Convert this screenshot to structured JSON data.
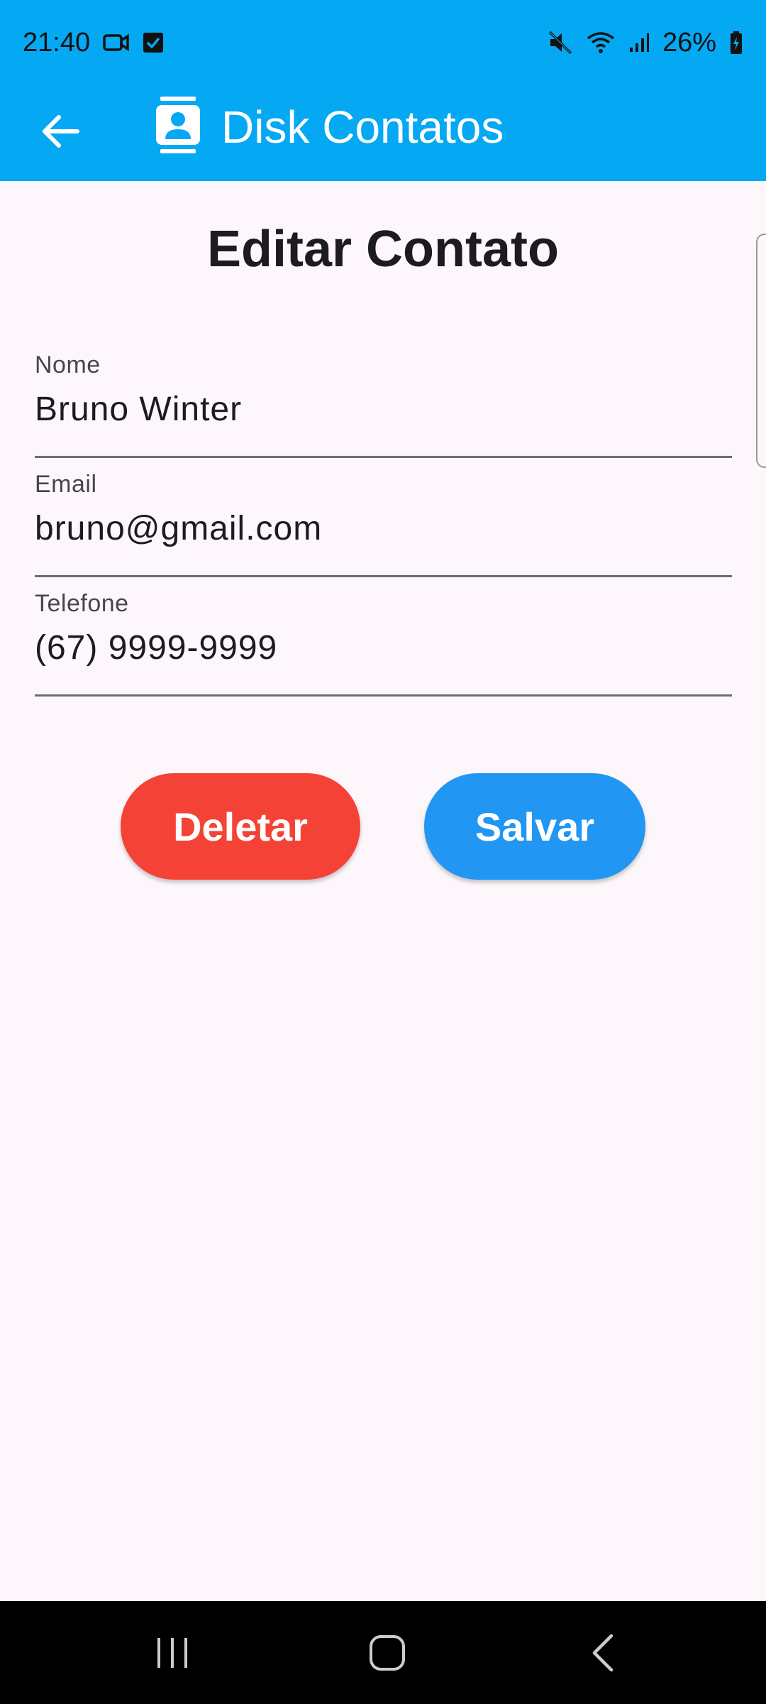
{
  "status_bar": {
    "time": "21:40",
    "battery": "26%",
    "icons": [
      "video-call-icon",
      "check-box-icon",
      "mute-icon",
      "wifi-icon",
      "signal-icon",
      "battery-charging-icon"
    ]
  },
  "app_bar": {
    "title": "Disk Contatos",
    "back_icon": "arrow-back-icon",
    "app_icon": "contact-card-icon",
    "color": "#05a8f2"
  },
  "page": {
    "title": "Editar Contato"
  },
  "form": {
    "nome": {
      "label": "Nome",
      "value": "Bruno Winter"
    },
    "email": {
      "label": "Email",
      "value": "bruno@gmail.com"
    },
    "telefone": {
      "label": "Telefone",
      "value": "(67) 9999-9999"
    }
  },
  "actions": {
    "delete_label": "Deletar",
    "delete_color": "#f44336",
    "save_label": "Salvar",
    "save_color": "#2196f3"
  },
  "nav_bar": {
    "icons": [
      "recent-apps-icon",
      "home-icon",
      "back-icon"
    ]
  }
}
